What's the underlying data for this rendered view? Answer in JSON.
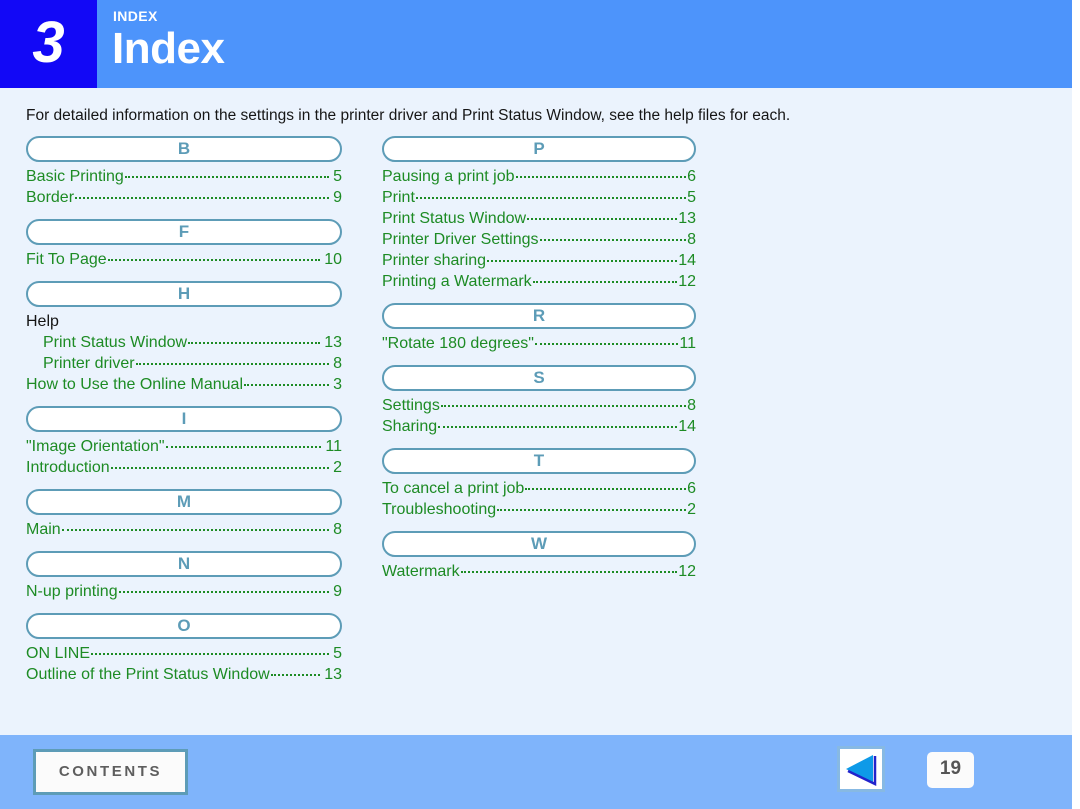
{
  "header": {
    "chapter_number": "3",
    "kicker": "INDEX",
    "title": "Index"
  },
  "intro": "For detailed information on the settings in the printer driver and Print Status Window, see the help files for each.",
  "index": {
    "left_column": [
      {
        "letter": "B",
        "entries": [
          {
            "title": "Basic Printing",
            "page": "5",
            "link": true,
            "sub": false
          },
          {
            "title": "Border",
            "page": "9",
            "link": true,
            "sub": false
          }
        ]
      },
      {
        "letter": "F",
        "entries": [
          {
            "title": "Fit To Page",
            "page": "10",
            "link": true,
            "sub": false
          }
        ]
      },
      {
        "letter": "H",
        "entries": [
          {
            "title": "Help",
            "page": "",
            "link": false,
            "sub": false
          },
          {
            "title": "Print Status Window",
            "page": "13",
            "link": true,
            "sub": true
          },
          {
            "title": "Printer driver",
            "page": "8",
            "link": true,
            "sub": true
          },
          {
            "title": "How to Use the Online Manual",
            "page": "3",
            "link": true,
            "sub": false
          }
        ]
      },
      {
        "letter": "I",
        "entries": [
          {
            "title": "\"Image Orientation\"",
            "page": "11",
            "link": true,
            "sub": false
          },
          {
            "title": "Introduction",
            "page": "2",
            "link": true,
            "sub": false
          }
        ]
      },
      {
        "letter": "M",
        "entries": [
          {
            "title": "Main",
            "page": "8",
            "link": true,
            "sub": false
          }
        ]
      },
      {
        "letter": "N",
        "entries": [
          {
            "title": "N-up printing",
            "page": "9",
            "link": true,
            "sub": false
          }
        ]
      },
      {
        "letter": "O",
        "entries": [
          {
            "title": "ON LINE",
            "page": "5",
            "link": true,
            "sub": false
          },
          {
            "title": "Outline of the Print Status Window",
            "page": "13",
            "link": true,
            "sub": false
          }
        ]
      }
    ],
    "right_column": [
      {
        "letter": "P",
        "entries": [
          {
            "title": "Pausing a print job",
            "page": "6",
            "link": true,
            "sub": false
          },
          {
            "title": "Print",
            "page": "5",
            "link": true,
            "sub": false
          },
          {
            "title": "Print Status Window",
            "page": "13",
            "link": true,
            "sub": false
          },
          {
            "title": "Printer Driver Settings",
            "page": "8",
            "link": true,
            "sub": false
          },
          {
            "title": "Printer sharing",
            "page": "14",
            "link": true,
            "sub": false
          },
          {
            "title": "Printing a Watermark",
            "page": "12",
            "link": true,
            "sub": false
          }
        ]
      },
      {
        "letter": "R",
        "entries": [
          {
            "title": "\"Rotate 180 degrees\"",
            "page": "11",
            "link": true,
            "sub": false
          }
        ]
      },
      {
        "letter": "S",
        "entries": [
          {
            "title": "Settings",
            "page": "8",
            "link": true,
            "sub": false
          },
          {
            "title": "Sharing",
            "page": "14",
            "link": true,
            "sub": false
          }
        ]
      },
      {
        "letter": "T",
        "entries": [
          {
            "title": "To cancel a print job",
            "page": "6",
            "link": true,
            "sub": false
          },
          {
            "title": "Troubleshooting",
            "page": "2",
            "link": true,
            "sub": false
          }
        ]
      },
      {
        "letter": "W",
        "entries": [
          {
            "title": "Watermark",
            "page": "12",
            "link": true,
            "sub": false
          }
        ]
      }
    ]
  },
  "footer": {
    "contents_label": "CONTENTS",
    "back_icon": "back-triangle-icon",
    "page_number": "19"
  },
  "colors": {
    "page_background": "#ebf3fd",
    "header_band": "#4d94fb",
    "chapter_badge": "#1208f6",
    "footer_band": "#7fb4fb",
    "link_green": "#1d8b24",
    "pill_border": "#5d9cb7",
    "arrow_fill": "#0e9ae8",
    "arrow_outline": "#2222cc"
  }
}
